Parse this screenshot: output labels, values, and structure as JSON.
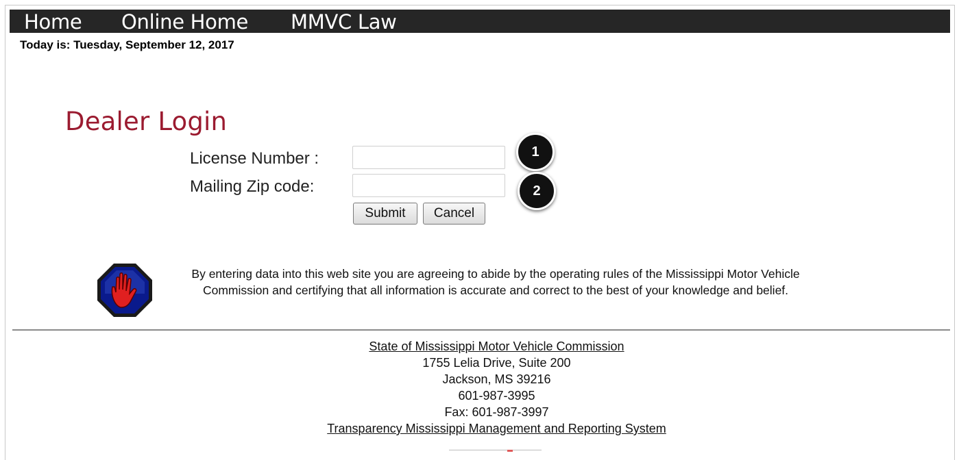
{
  "nav": {
    "items": [
      {
        "label": "Home"
      },
      {
        "label": "Online Home"
      },
      {
        "label": "MMVC Law"
      }
    ]
  },
  "date_line": "Today is: Tuesday, September 12, 2017",
  "login": {
    "title": "Dealer Login",
    "license_label": "License Number :",
    "license_value": "",
    "zip_label": "Mailing Zip code:",
    "zip_value": "",
    "submit_label": "Submit",
    "cancel_label": "Cancel"
  },
  "callouts": [
    {
      "number": "1"
    },
    {
      "number": "2"
    }
  ],
  "disclaimer": "By entering data into this web site you are agreeing to abide by the operating rules of the Mississippi Motor Vehicle Commission and certifying that all information is accurate and correct to the best of your knowledge and belief.",
  "footer": {
    "org_link": "State of Mississippi Motor Vehicle Commission",
    "address_line1": "1755 Lelia Drive, Suite 200",
    "address_line2": "Jackson, MS 39216",
    "phone": "601-987-3995",
    "fax": "Fax: 601-987-3997",
    "transparency_link": "Transparency Mississippi Management and Reporting System"
  },
  "colors": {
    "nav_bg": "#262626",
    "title": "#9b1b30",
    "stop_octagon": "#0a1a8c",
    "stop_hand": "#e02020"
  },
  "icons": {
    "stop": "stop-hand-icon"
  }
}
